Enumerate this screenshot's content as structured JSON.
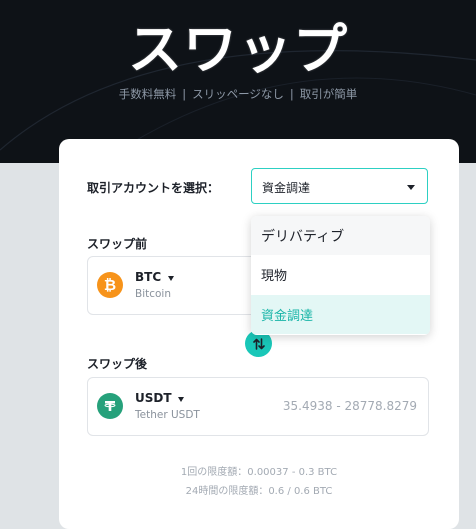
{
  "hero": {
    "title": "スワップ",
    "subtitle": [
      "手数料無料",
      "スリッページなし",
      "取引が簡単"
    ],
    "separator": "|"
  },
  "form": {
    "account_label": "取引アカウントを選択：",
    "account_selected": "資金調達",
    "from_label": "スワップ前",
    "to_label": "スワップ後",
    "from": {
      "symbol": "BTC",
      "name": "Bitcoin",
      "icon": "bitcoin-icon",
      "color": "#f7931a"
    },
    "to": {
      "symbol": "USDT",
      "name": "Tether USDT",
      "icon": "tether-icon",
      "color": "#26a17b",
      "range": "35.4938 - 28778.8279"
    },
    "limit_single": "1回の限度額：0.00037 - 0.3 BTC",
    "limit_24h": "24時間の限度額：0.6 / 0.6 BTC"
  },
  "dropdown": {
    "options": [
      "デリバティブ",
      "現物",
      "資金調達"
    ],
    "selected_index": 2
  },
  "colors": {
    "accent": "#19c7b8",
    "hero_bg": "#0e1217",
    "page_bg": "#dfe3e6"
  }
}
